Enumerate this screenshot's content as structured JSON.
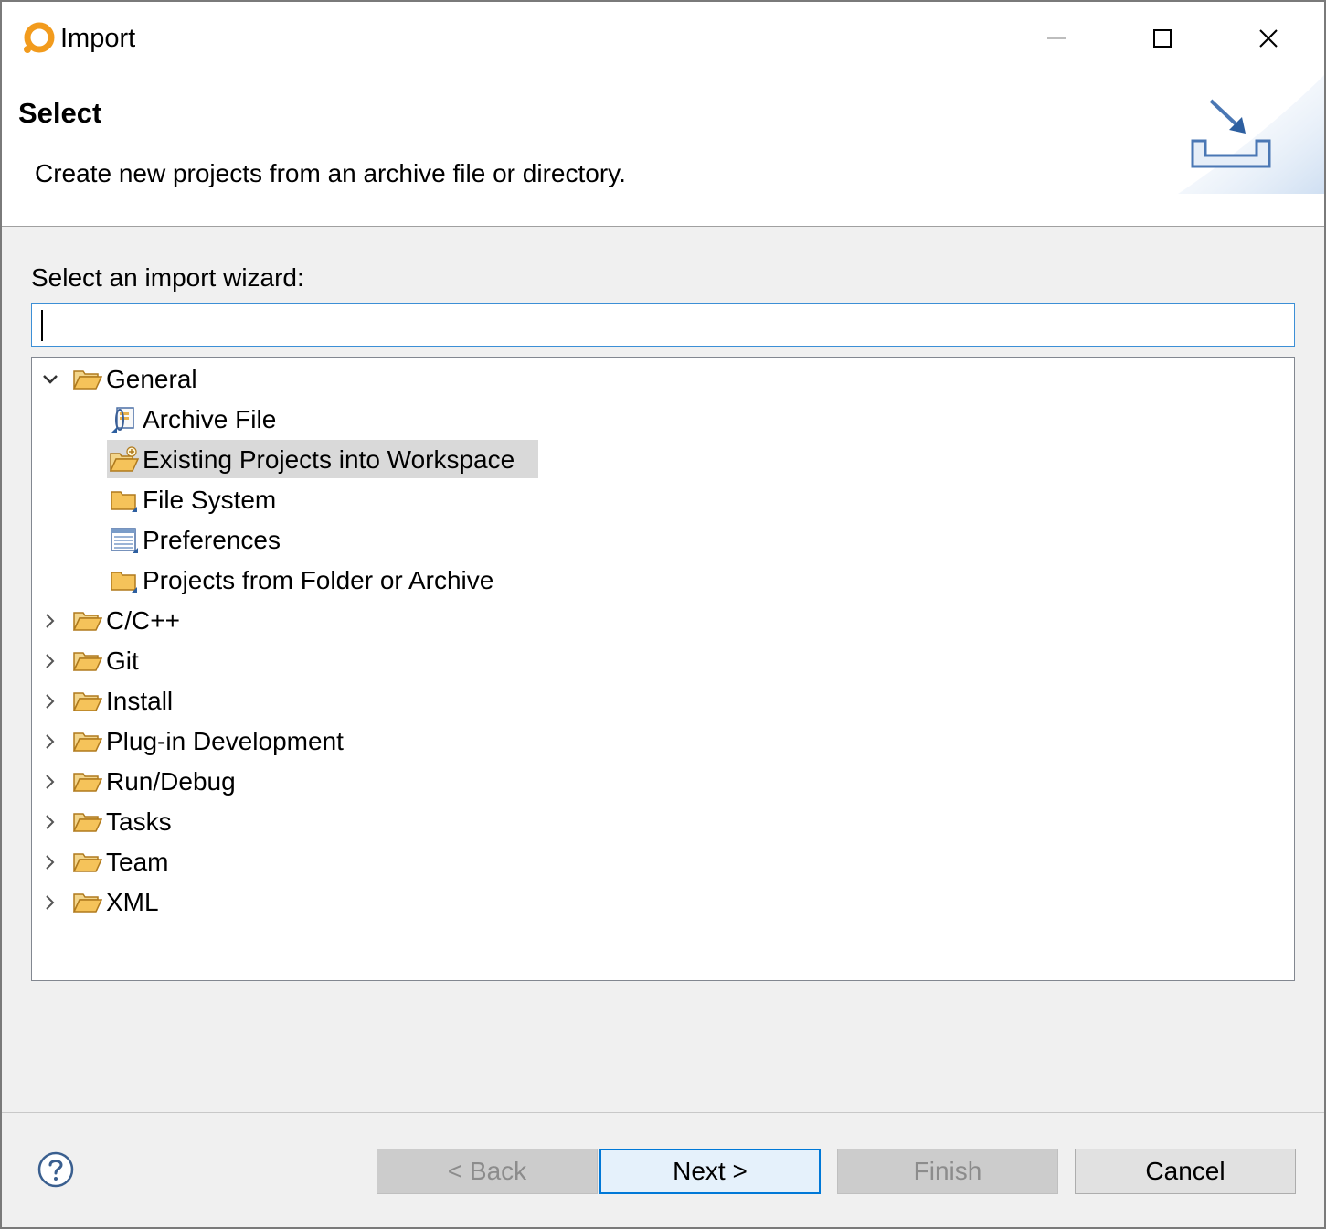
{
  "window": {
    "title": "Import",
    "controls": [
      "minimize",
      "maximize",
      "close"
    ]
  },
  "banner": {
    "title": "Select",
    "description": "Create new projects from an archive file or directory."
  },
  "filter": {
    "label": "Select an import wizard:",
    "value": ""
  },
  "tree": {
    "nodes": [
      {
        "label": "General",
        "expanded": true,
        "icon": "folder-open-icon"
      },
      {
        "label": "Archive File",
        "icon": "archive-file-icon"
      },
      {
        "label": "Existing Projects into Workspace",
        "icon": "existing-projects-icon",
        "selected": true
      },
      {
        "label": "File System",
        "icon": "folder-icon"
      },
      {
        "label": "Preferences",
        "icon": "preferences-icon"
      },
      {
        "label": "Projects from Folder or Archive",
        "icon": "folder-icon"
      },
      {
        "label": "C/C++",
        "expanded": false,
        "icon": "folder-open-icon"
      },
      {
        "label": "Git",
        "expanded": false,
        "icon": "folder-open-icon"
      },
      {
        "label": "Install",
        "expanded": false,
        "icon": "folder-open-icon"
      },
      {
        "label": "Plug-in Development",
        "expanded": false,
        "icon": "folder-open-icon"
      },
      {
        "label": "Run/Debug",
        "expanded": false,
        "icon": "folder-open-icon"
      },
      {
        "label": "Tasks",
        "expanded": false,
        "icon": "folder-open-icon"
      },
      {
        "label": "Team",
        "expanded": false,
        "icon": "folder-open-icon"
      },
      {
        "label": "XML",
        "expanded": false,
        "icon": "folder-open-icon"
      }
    ]
  },
  "buttons": {
    "back": "< Back",
    "next": "Next >",
    "finish": "Finish",
    "cancel": "Cancel"
  },
  "colors": {
    "accent": "#0078d7",
    "folder": "#e8b04c",
    "selection": "#d9d9d9"
  }
}
